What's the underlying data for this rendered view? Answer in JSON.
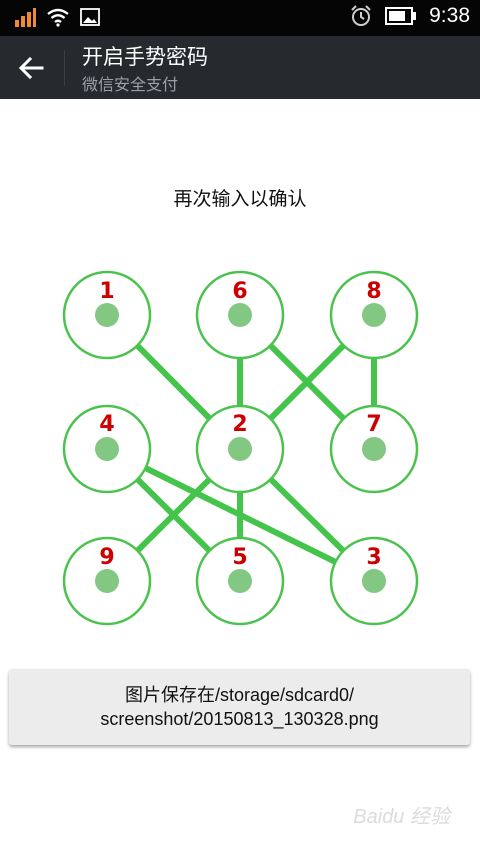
{
  "status_bar": {
    "time": "9:38",
    "icons": [
      "signal-icon",
      "wifi-icon",
      "image-notification-icon",
      "alarm-icon",
      "battery-icon"
    ]
  },
  "action_bar": {
    "title": "开启手势密码",
    "subtitle": "微信安全支付"
  },
  "prompt": "再次输入以确认",
  "pattern": {
    "node_labels": [
      "1",
      "6",
      "8",
      "4",
      "2",
      "7",
      "9",
      "5",
      "3"
    ],
    "entered_sequence": [
      "1",
      "2",
      "6",
      "7",
      "8",
      "2",
      "5",
      "4",
      "3",
      "2",
      "9"
    ],
    "colors": {
      "ring": "#4cc24e",
      "dot": "#82c882",
      "line": "#44c44a",
      "label": "#cc0000"
    }
  },
  "toast": {
    "line1": "图片保存在/storage/sdcard0/",
    "line2": "screenshot/20150813_130328.png"
  },
  "watermark": "Baidu 经验"
}
